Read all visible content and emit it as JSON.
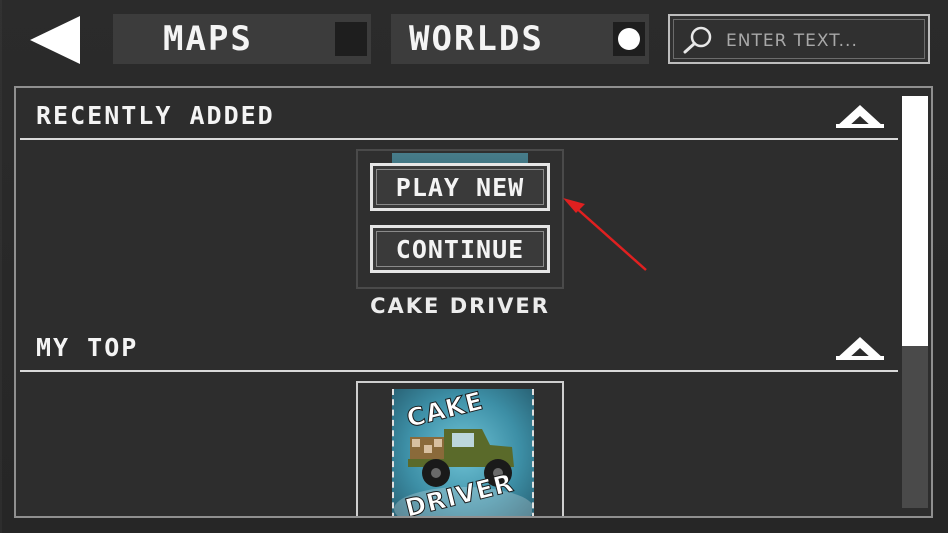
{
  "header": {
    "back_icon": "back-arrow-icon",
    "tabs": [
      {
        "label": "MAPS",
        "selected": false
      },
      {
        "label": "WORLDS",
        "selected": true
      }
    ],
    "search": {
      "placeholder": "ENTER TEXT...",
      "icon": "search-icon"
    }
  },
  "sections": {
    "recent": {
      "title": "RECENTLY ADDED",
      "icon": "chevron-up-icon",
      "item": {
        "name": "CAKE DRIVER",
        "play_label": "PLAY NEW",
        "continue_label": "CONTINUE"
      }
    },
    "top": {
      "title": "MY TOP",
      "icon": "chevron-up-icon",
      "item": {
        "thumb_line1": "CAKE",
        "thumb_line2": "DRIVER"
      }
    }
  },
  "colors": {
    "background": "#2a2a2a",
    "panel": "#2d2d2d",
    "tab": "#3c3c3c",
    "annotation_arrow": "#e02020"
  }
}
